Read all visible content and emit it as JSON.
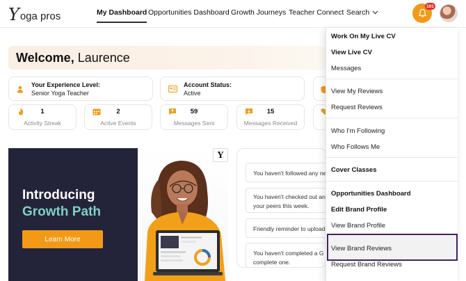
{
  "brand": {
    "logo_y": "Y",
    "logo_rest": "oga pros"
  },
  "nav": {
    "items": [
      {
        "label": "My Dashboard"
      },
      {
        "label": "Opportunities Dashboard"
      },
      {
        "label": "Growth Journeys"
      },
      {
        "label": "Teacher Connect"
      }
    ],
    "search_label": "Search",
    "notification_count": "101"
  },
  "welcome": {
    "greeting": "Welcome,",
    "name": "Laurence"
  },
  "info": [
    {
      "label": "Your Experience Level:",
      "value": "Senior Yoga Teacher"
    },
    {
      "label": "Account Status:",
      "value": "Active"
    }
  ],
  "stats": [
    {
      "value": "1",
      "label": "Activity Streak"
    },
    {
      "value": "2",
      "label": "Active Events"
    },
    {
      "value": "59",
      "label": "Messages Sent"
    },
    {
      "value": "15",
      "label": "Messages Received"
    }
  ],
  "promo": {
    "line1": "Introducing",
    "line2": "Growth Path",
    "button": "Learn More",
    "logo": "Y"
  },
  "reminders": [
    {
      "text": "You haven't followed any ne"
    },
    {
      "text": "You haven't checked out any your peers this week."
    },
    {
      "text": "Friendly reminder to upload"
    },
    {
      "text": "You haven't completed a G complete one."
    }
  ],
  "dropdown": {
    "items": [
      {
        "label": "Work On My Live CV",
        "bold": true
      },
      {
        "label": "View Live CV",
        "bold": true
      },
      {
        "label": "Messages",
        "bold": false
      },
      {
        "label": "View My Reviews",
        "bold": false
      },
      {
        "label": "Request Reviews",
        "bold": false
      },
      {
        "label": "Who I'm Following",
        "bold": false
      },
      {
        "label": "Who Follows Me",
        "bold": false
      },
      {
        "label": "Cover Classes",
        "bold": true
      },
      {
        "label": "Opportunities Dashboard",
        "bold": true
      },
      {
        "label": "Edit Brand Profile",
        "bold": true
      },
      {
        "label": "View Brand Profile",
        "bold": false
      },
      {
        "label": "View Brand Reviews",
        "bold": false
      },
      {
        "label": "Request Brand Reviews",
        "bold": false
      }
    ],
    "highlighted": "View Brand Reviews"
  },
  "colors": {
    "accent": "#f29a17",
    "dark": "#23233a",
    "teal": "#7fd1bf",
    "highlight_border": "#48205e"
  }
}
